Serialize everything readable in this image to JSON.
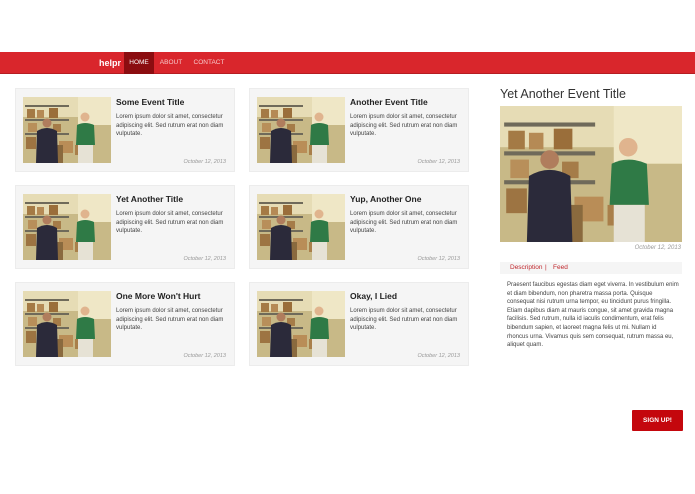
{
  "navbar": {
    "brand": "helpr",
    "items": [
      {
        "label": "HOME",
        "active": true
      },
      {
        "label": "ABOUT",
        "active": false
      },
      {
        "label": "CONTACT",
        "active": false
      }
    ]
  },
  "events": [
    {
      "title": "Some Event Title",
      "text": "Lorem ipsum dolor sit amet, consectetur adipiscing elit. Sed rutrum erat non diam vulputate.",
      "date": "October 12, 2013"
    },
    {
      "title": "Another Event Title",
      "text": "Lorem ipsum dolor sit amet, consectetur adipiscing elit. Sed rutrum erat non diam vulputate.",
      "date": "October 12, 2013"
    },
    {
      "title": "Yet Another Title",
      "text": "Lorem ipsum dolor sit amet, consectetur adipiscing elit. Sed rutrum erat non diam vulputate.",
      "date": "October 12, 2013"
    },
    {
      "title": "Yup, Another One",
      "text": "Lorem ipsum dolor sit amet, consectetur adipiscing elit. Sed rutrum erat non diam vulputate.",
      "date": "October 12, 2013"
    },
    {
      "title": "One More Won't Hurt",
      "text": "Lorem ipsum dolor sit amet, consectetur adipiscing elit. Sed rutrum erat non diam vulputate.",
      "date": "October 12, 2013"
    },
    {
      "title": "Okay, I Lied",
      "text": "Lorem ipsum dolor sit amet, consectetur adipiscing elit. Sed rutrum erat non diam vulputate.",
      "date": "October 12, 2013"
    }
  ],
  "sidebar": {
    "title": "Yet Another Event Title",
    "date": "October 12, 2013",
    "tabs": {
      "description": "Description",
      "separator": "|",
      "feed": "Feed"
    },
    "description": "Praesent faucibus egestas diam eget viverra. In vestibulum enim et diam bibendum, non pharetra massa porta. Quisque consequat nisi rutrum urna tempor, eu tincidunt purus fringilla. Etiam dapibus diam at mauris congue, sit amet gravida magna facilisis. Sed rutrum, nulla id iaculis condimentum, erat felis bibendum sapien, et laoreet magna felis ut mi. Nullam id rhoncus urna. Vivamus quis sem consequat, rutrum massa eu, aliquet quam."
  },
  "signup": {
    "label": "SIGN UP!"
  },
  "colors": {
    "primary": "#d9262c",
    "active_nav": "#8b0d10",
    "button": "#c4070d"
  }
}
